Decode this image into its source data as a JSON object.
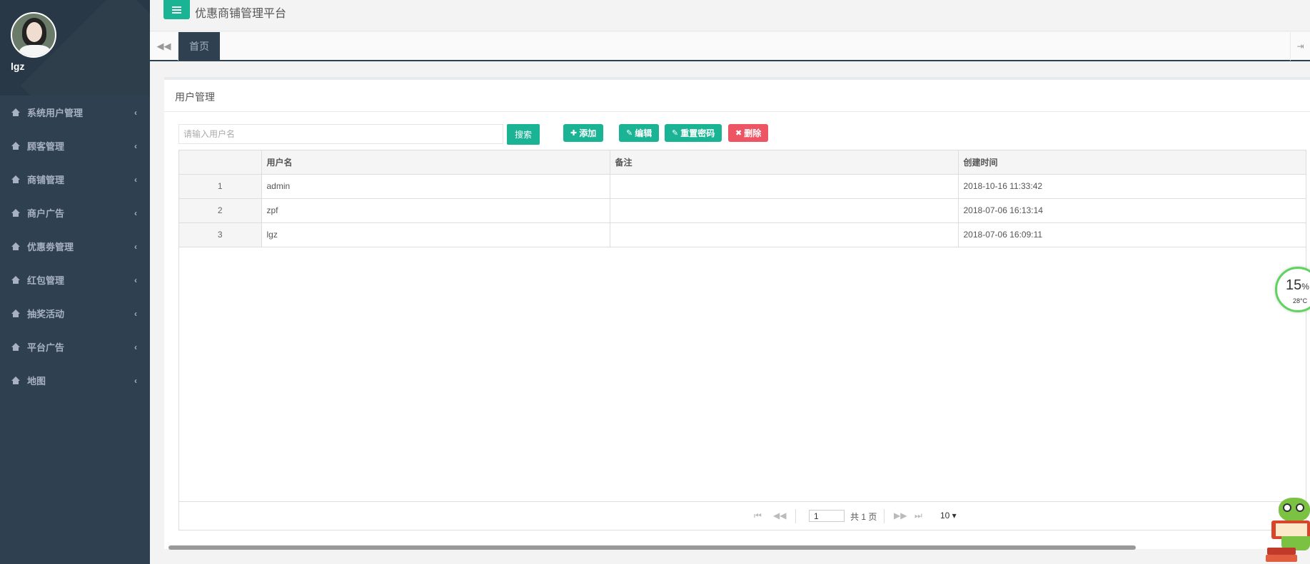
{
  "app": {
    "title": "优惠商铺管理平台"
  },
  "user": {
    "name": "lgz"
  },
  "sidebar": {
    "items": [
      {
        "label": "系统用户管理"
      },
      {
        "label": "顾客管理"
      },
      {
        "label": "商铺管理"
      },
      {
        "label": "商户广告"
      },
      {
        "label": "优惠劵管理"
      },
      {
        "label": "红包管理"
      },
      {
        "label": "抽奖活动"
      },
      {
        "label": "平台广告"
      },
      {
        "label": "地图"
      }
    ]
  },
  "tabs": {
    "home": "首页"
  },
  "panel": {
    "title": "用户管理",
    "search": {
      "placeholder": "请输入用户名",
      "button": "搜索"
    },
    "actions": {
      "add": "添加",
      "edit": "编辑",
      "reset": "重置密码",
      "delete": "删除"
    }
  },
  "table": {
    "columns": [
      "",
      "用户名",
      "备注",
      "创建时间"
    ],
    "rows": [
      {
        "num": "1",
        "username": "admin",
        "remark": "",
        "created": "2018-10-16 11:33:42"
      },
      {
        "num": "2",
        "username": "zpf",
        "remark": "",
        "created": "2018-07-06 16:13:14"
      },
      {
        "num": "3",
        "username": "lgz",
        "remark": "",
        "created": "2018-07-06 16:09:11"
      }
    ]
  },
  "pager": {
    "page": "1",
    "total": "共 1 页",
    "size": "10 ▾"
  },
  "widget": {
    "percent": "15",
    "percent_unit": "%",
    "temperature": "28°C"
  },
  "colors": {
    "sidebar": "#2f4050",
    "accent": "#1ab394",
    "danger": "#ed5565"
  }
}
